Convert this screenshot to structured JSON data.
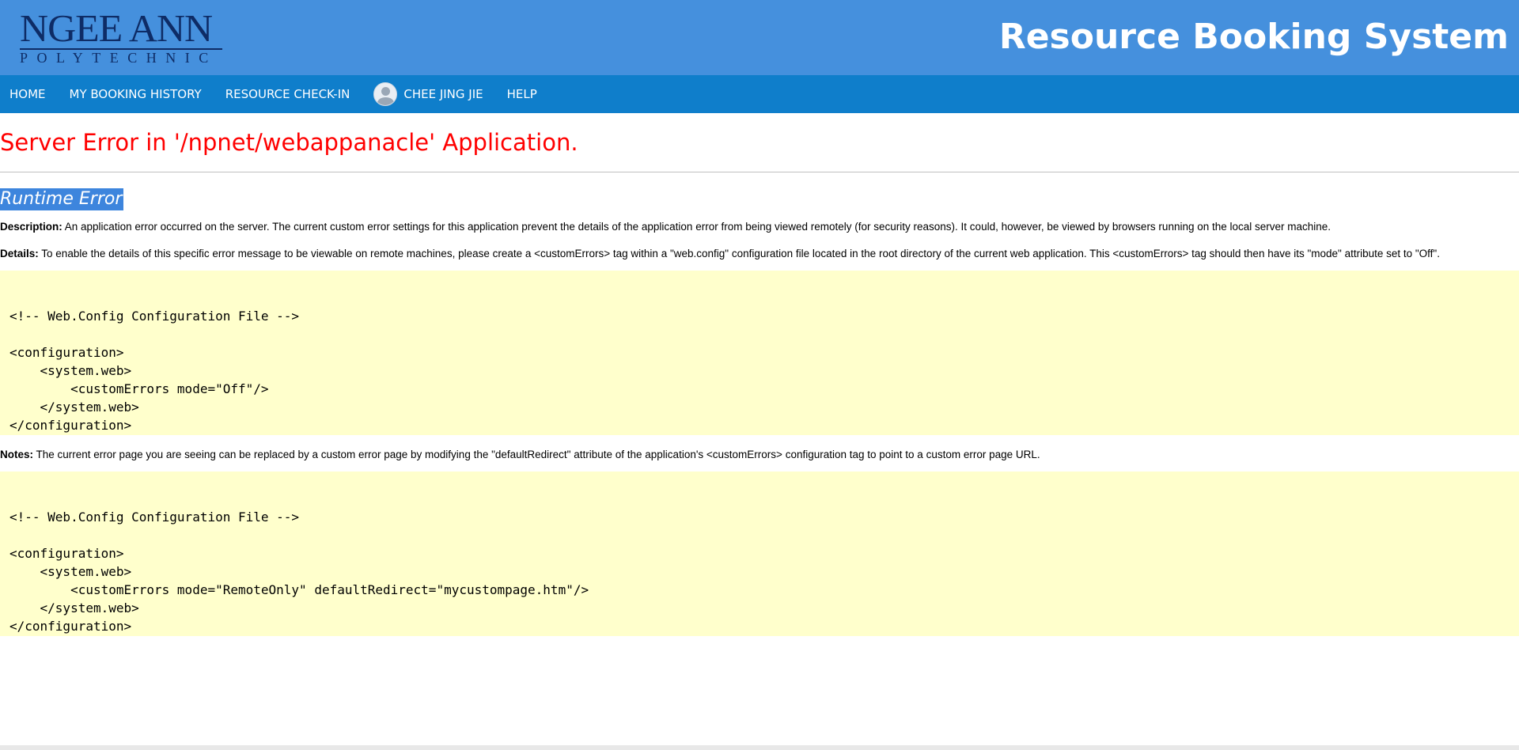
{
  "header": {
    "logo_main": "NGEE ANN",
    "logo_sub": "POLYTECHNIC",
    "title": "Resource Booking System"
  },
  "nav": {
    "home": "HOME",
    "history": "MY BOOKING HISTORY",
    "checkin": "RESOURCE CHECK-IN",
    "user": "CHEE JING JIE",
    "help": "HELP"
  },
  "error": {
    "title": "Server Error in '/npnet/webappanacle' Application.",
    "runtime": "Runtime Error",
    "description_label": "Description:",
    "description": " An application error occurred on the server. The current custom error settings for this application prevent the details of the application error from being viewed remotely (for security reasons). It could, however, be viewed by browsers running on the local server machine.",
    "details_label": "Details:",
    "details": " To enable the details of this specific error message to be viewable on remote machines, please create a <customErrors> tag within a \"web.config\" configuration file located in the root directory of the current web application. This <customErrors> tag should then have its \"mode\" attribute set to \"Off\".",
    "code1": "\n<!-- Web.Config Configuration File -->\n\n<configuration>\n    <system.web>\n        <customErrors mode=\"Off\"/>\n    </system.web>\n</configuration>",
    "notes_label": "Notes:",
    "notes": " The current error page you are seeing can be replaced by a custom error page by modifying the \"defaultRedirect\" attribute of the application's <customErrors> configuration tag to point to a custom error page URL.",
    "code2": "\n<!-- Web.Config Configuration File -->\n\n<configuration>\n    <system.web>\n        <customErrors mode=\"RemoteOnly\" defaultRedirect=\"mycustompage.htm\"/>\n    </system.web>\n</configuration>"
  },
  "icons": {
    "avatar": "user-avatar-icon"
  },
  "colors": {
    "header_bg": "#4590dd",
    "nav_bg": "#0f7ecb",
    "error_title": "#ff0000",
    "code_bg": "#ffffcc",
    "selection": "#3d85dd"
  }
}
